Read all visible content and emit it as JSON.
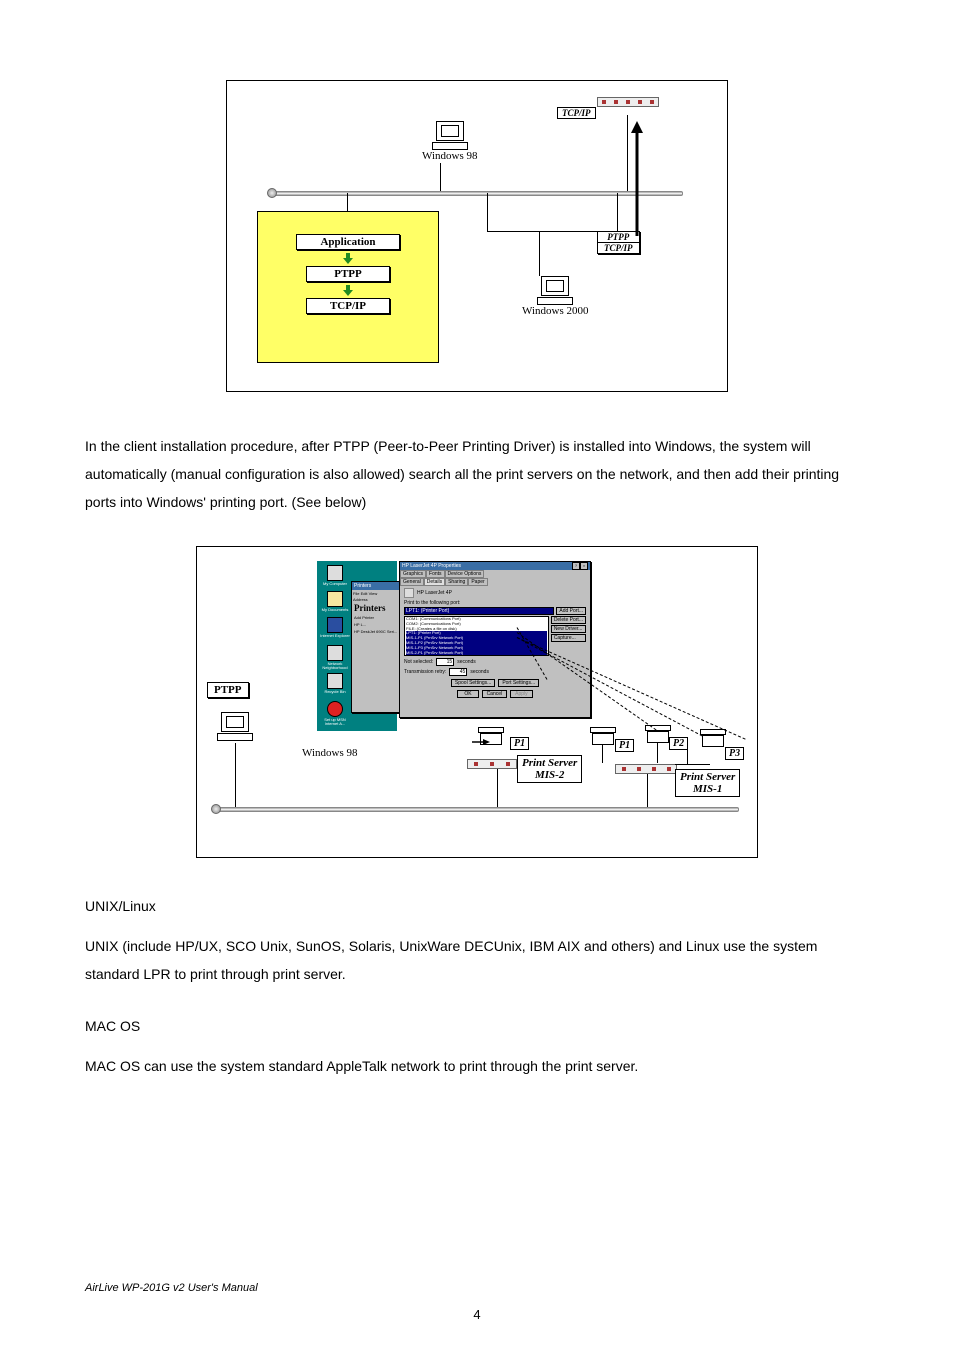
{
  "figure1": {
    "tcpip_top": "TCP/IP",
    "win98": "Windows 98",
    "win2000": "Windows 2000",
    "ptpp": "PTPP",
    "tcpip": "TCP/IP",
    "application": "Application",
    "stack_ptpp": "PTPP",
    "stack_tcpip": "TCP/IP"
  },
  "para1": "In the client installation procedure, after PTPP (Peer-to-Peer Printing Driver) is installed into Windows, the system will automatically (manual configuration is also allowed) search all the print servers on the network, and then add their printing ports into Windows' printing port. (See below)",
  "figure2": {
    "ptpp": "PTPP",
    "win98": "Windows 98",
    "p1": "P1",
    "p2": "P2",
    "p3": "P3",
    "ps2_l1": "Print Server",
    "ps2_l2": "MIS-2",
    "ps1_l1": "Print Server",
    "ps1_l2": "MIS-1",
    "desktop": {
      "icons": [
        "My Computer",
        "My Documents",
        "Internet Explorer",
        "Network Neighborhood",
        "Recycle Bin",
        "Set up MSN Internet A..."
      ],
      "printers_title": "Printers",
      "printers_menu": [
        "File",
        "Edit",
        "View"
      ],
      "printers_addr": "Address",
      "printer_items": [
        "Add Printer",
        "HP L...",
        "HP DeskJet 690C Seri..."
      ]
    },
    "dialog": {
      "title": "HP LaserJet 4P Properties",
      "tabs_row1": [
        "Graphics",
        "Fonts",
        "Device Options"
      ],
      "tabs_row2": [
        "General",
        "Details",
        "Sharing",
        "Paper"
      ],
      "devname": "HP LaserJet 4P",
      "print_port_label": "Print to the following port:",
      "port_selected": "LPT1: (Printer Port)",
      "ports": [
        "COM1: (Communications Port)",
        "COM2: (Communications Port)",
        "FILE: (Creates a file on disk)",
        "LPT1: (Printer Port)",
        "MIS-1-P1 (PrnSrv Network Port)",
        "MIS-1-P2 (PrnSrv Network Port)",
        "MIS-1-P3 (PrnSrv Network Port)",
        "MIS-2-P1 (PrnSrv Network Port)"
      ],
      "btn_addport": "Add Port...",
      "btn_delport": "Delete Port...",
      "btn_newdrv": "New Driver...",
      "btn_capture": "Capture...",
      "not_selected_label": "Not selected:",
      "not_selected_val": "15",
      "unit": "seconds",
      "retry_label": "Transmission retry:",
      "retry_val": "45",
      "btn_spool": "Spool Settings...",
      "btn_port": "Port Settings...",
      "btn_ok": "OK",
      "btn_cancel": "Cancel",
      "btn_apply": "Apply"
    }
  },
  "unix_head": "UNIX/Linux",
  "unix_para": "UNIX (include HP/UX, SCO Unix, SunOS, Solaris, UnixWare DECUnix, IBM AIX and others) and Linux use the system standard LPR to print through print server.",
  "mac_head": "MAC OS",
  "mac_para": "MAC OS can use the system standard AppleTalk network to print through the print server.",
  "footer": "AirLive WP-201G v2 User's Manual",
  "pagenum": "4"
}
